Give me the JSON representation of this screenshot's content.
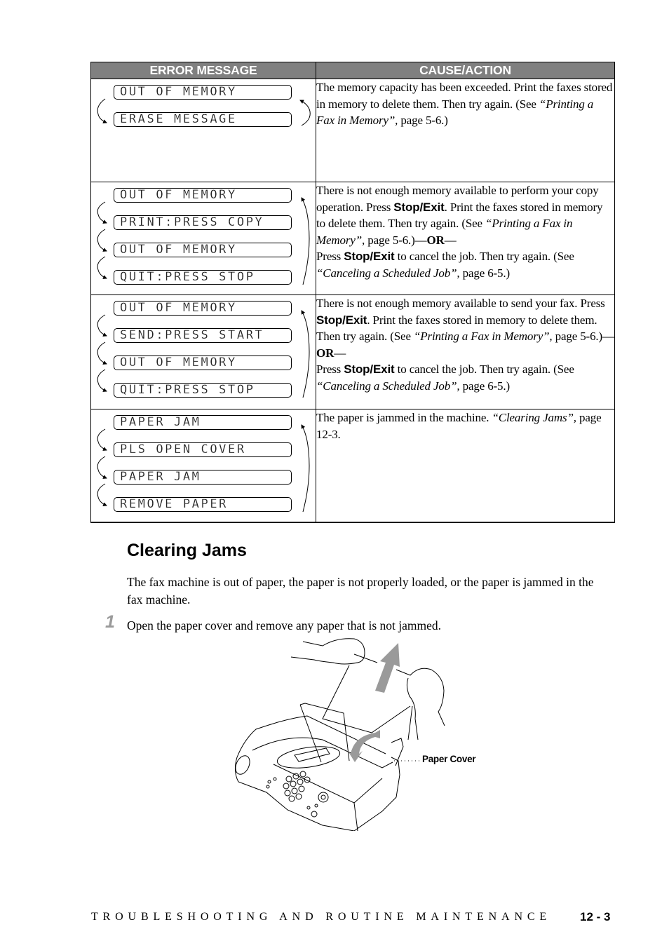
{
  "table": {
    "headers": {
      "error_message": "ERROR MESSAGE",
      "cause_action": "CAUSE/ACTION"
    },
    "rows": [
      {
        "messages": [
          "OUT OF MEMORY",
          "ERASE MESSAGE"
        ],
        "cause": {
          "t1": "The memory capacity has been exceeded. Print the faxes stored in memory to delete them. Then try again. (See ",
          "ref1": "“Printing a Fax in Memory”,",
          "t2": " page 5-6.)"
        }
      },
      {
        "messages": [
          "OUT OF MEMORY",
          "PRINT:PRESS COPY",
          "OUT OF MEMORY",
          "QUIT:PRESS STOP"
        ],
        "cause": {
          "t1": "There is not enough memory available to perform your copy operation. Press ",
          "key1": "Stop/Exit",
          "t2": ". Print the faxes stored in memory to delete them. Then try again. (See ",
          "ref1": "“Printing a Fax in Memory”,",
          "t3": " page 5-6.)—",
          "or": "OR",
          "t4": "—",
          "t5": "Press ",
          "key2": "Stop/Exit",
          "t6": " to cancel the job. Then try again. (See ",
          "ref2": "“Canceling a Scheduled Job”,",
          "t7": " page 6-5.)"
        }
      },
      {
        "messages": [
          "OUT OF MEMORY",
          "SEND:PRESS START",
          "OUT OF MEMORY",
          "QUIT:PRESS STOP"
        ],
        "cause": {
          "t1": "There is not enough memory available to send your fax. Press ",
          "key1": "Stop/Exit",
          "t2": ". Print the faxes stored in memory to delete them. Then try again. (See ",
          "ref1": "“Printing a Fax in Memory”,",
          "t3": " page 5-6.)—",
          "or": "OR",
          "t4": "—",
          "t5": "Press ",
          "key2": "Stop/Exit",
          "t6": " to cancel the job. Then try again. (See ",
          "ref2": "“Canceling a Scheduled Job”,",
          "t7": " page 6-5.)"
        }
      },
      {
        "messages": [
          "PAPER JAM",
          "PLS OPEN COVER",
          "PAPER JAM",
          "REMOVE PAPER"
        ],
        "cause": {
          "t1": "The paper is jammed in the machine. ",
          "ref1": "“Clearing Jams”,",
          "t2": " page 12-3."
        }
      }
    ]
  },
  "section": {
    "title": "Clearing Jams",
    "intro": "The fax machine is out of paper, the paper is not properly loaded, or the paper is jammed in the fax machine.",
    "steps": [
      {
        "number": "1",
        "text": "Open the paper cover and remove any paper that is not jammed."
      }
    ],
    "figure_callout": "Paper Cover"
  },
  "footer": {
    "chapter": "TROUBLESHOOTING AND ROUTINE MAINTENANCE",
    "page": "12 - 3"
  }
}
